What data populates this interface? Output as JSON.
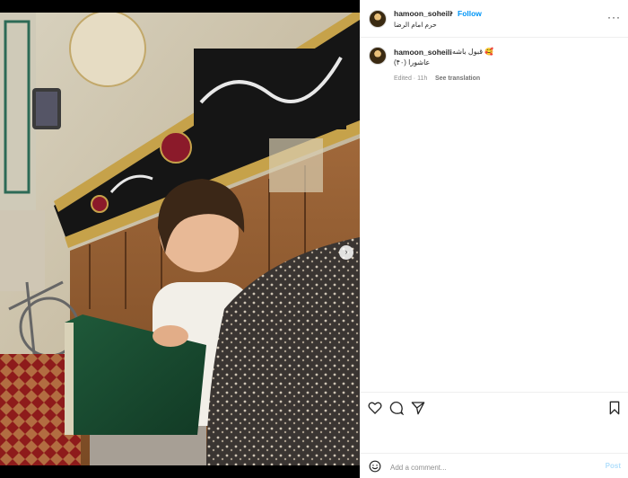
{
  "post": {
    "username": "hamoon_soheili",
    "separator": "•",
    "follow_label": "Follow",
    "location": "حرم امام الرضا",
    "more_label": "···"
  },
  "caption": {
    "username": "hamoon_soheili",
    "line1": "قبول باشه 🥰",
    "line2": "عاشورا (۴۰)",
    "edited": "Edited · 11h",
    "see_translation": "See translation"
  },
  "actions": {
    "like": "heart-icon",
    "comment": "comment-icon",
    "share": "send-icon",
    "save": "bookmark-icon"
  },
  "comment": {
    "placeholder": "Add a comment...",
    "post_label": "Post"
  },
  "photo": {
    "description_icon": "carousel-next-icon",
    "next_glyph": "›"
  },
  "colors": {
    "link": "#0095f6",
    "text": "#262626",
    "muted": "#8e8e8e",
    "post_disabled": "#b2dffc"
  }
}
